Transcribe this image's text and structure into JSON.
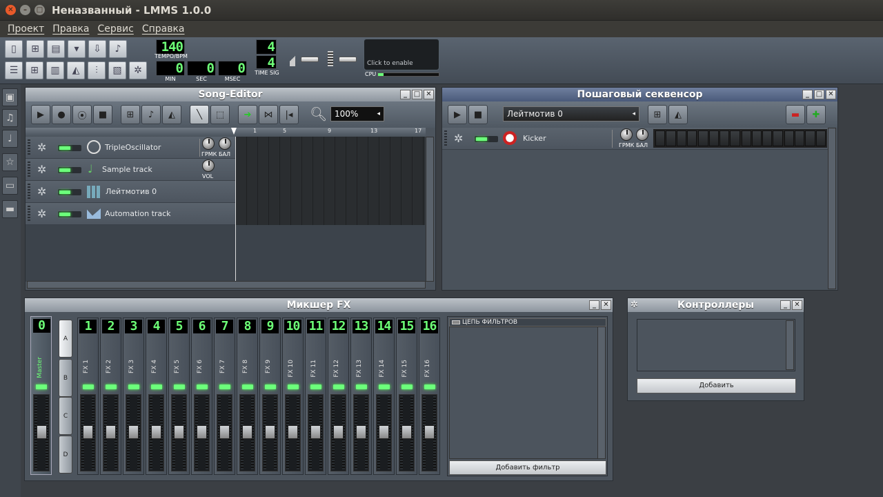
{
  "window": {
    "title": "Неназванный - LMMS 1.0.0"
  },
  "menu": [
    "Проект",
    "Правка",
    "Сервис",
    "Справка"
  ],
  "transport": {
    "tempo": "140",
    "tempo_label": "TEMPO/BPM",
    "min": "0",
    "sec": "0",
    "msec": "0",
    "min_label": "MIN",
    "sec_label": "SEC",
    "msec_label": "MSEC",
    "timesig_top": "4",
    "timesig_bottom": "4",
    "timesig_label": "TIME SIG",
    "cpu_text": "Click to enable",
    "cpu_label": "CPU"
  },
  "song_editor": {
    "title": "Song-Editor",
    "zoom": "100%",
    "ruler": [
      "1",
      "5",
      "9",
      "13",
      "17"
    ],
    "tracks": [
      {
        "name": "TripleOscillator",
        "icon": "oscillator-icon",
        "knobs": [
          "ГРМК",
          "БАЛ"
        ]
      },
      {
        "name": "Sample track",
        "icon": "note-icon",
        "knobs": [
          "VOL"
        ]
      },
      {
        "name": "Лейтмотив 0",
        "icon": "beat-icon",
        "knobs": []
      },
      {
        "name": "Automation track",
        "icon": "automation-icon",
        "knobs": []
      }
    ]
  },
  "sequencer": {
    "title": "Пошаговый секвенсор",
    "pattern": "Лейтмотив 0",
    "track": {
      "name": "Kicker",
      "knobs": [
        "ГРМК",
        "БАЛ"
      ]
    },
    "steps": 16
  },
  "mixer": {
    "title": "Микшер FX",
    "master_num": "0",
    "master_label": "Master",
    "groups": [
      "A",
      "B",
      "C",
      "D"
    ],
    "channels": [
      {
        "num": "1",
        "name": "FX 1"
      },
      {
        "num": "2",
        "name": "FX 2"
      },
      {
        "num": "3",
        "name": "FX 3"
      },
      {
        "num": "4",
        "name": "FX 4"
      },
      {
        "num": "5",
        "name": "FX 5"
      },
      {
        "num": "6",
        "name": "FX 6"
      },
      {
        "num": "7",
        "name": "FX 7"
      },
      {
        "num": "8",
        "name": "FX 8"
      },
      {
        "num": "9",
        "name": "FX 9"
      },
      {
        "num": "10",
        "name": "FX 10"
      },
      {
        "num": "11",
        "name": "FX 11"
      },
      {
        "num": "12",
        "name": "FX 12"
      },
      {
        "num": "13",
        "name": "FX 13"
      },
      {
        "num": "14",
        "name": "FX 14"
      },
      {
        "num": "15",
        "name": "FX 15"
      },
      {
        "num": "16",
        "name": "FX 16"
      }
    ],
    "effects_chain_label": "ЦЕПЬ ФИЛЬТРОВ",
    "add_effect": "Добавить фильтр"
  },
  "controllers": {
    "title": "Контроллеры",
    "add": "Добавить"
  },
  "colors": {
    "lcd": "#6dff77",
    "panel": "#4c545d",
    "active_title": "#4a5a7a"
  }
}
